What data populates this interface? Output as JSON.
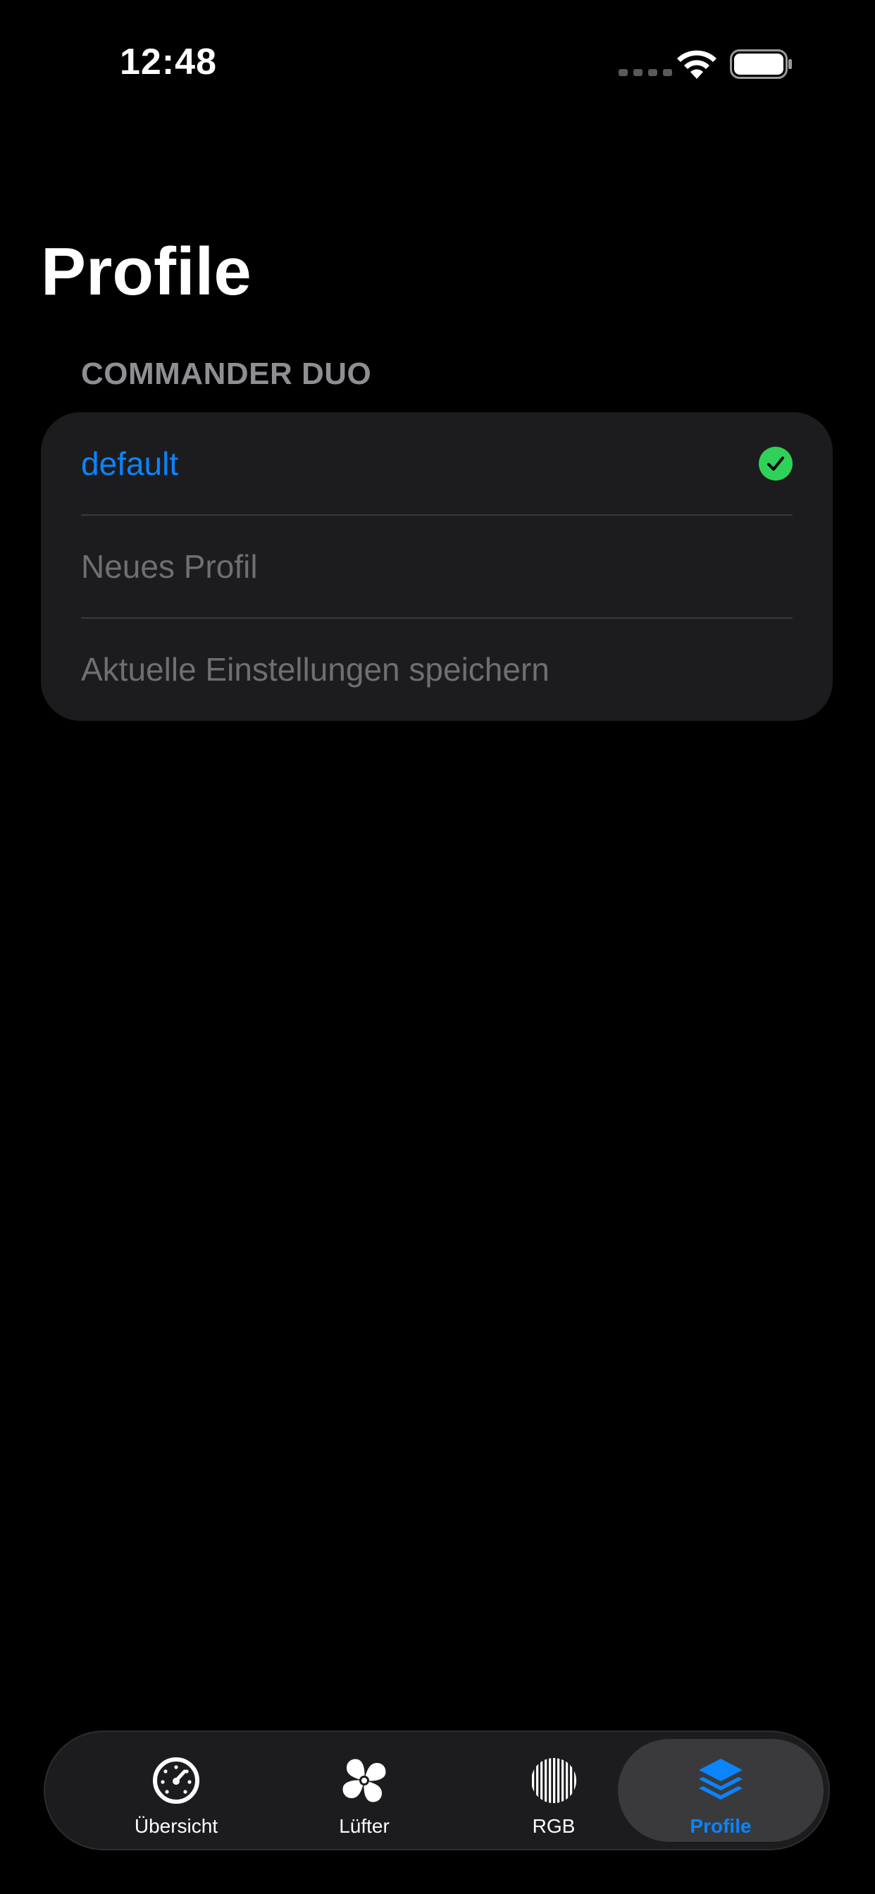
{
  "status_bar": {
    "time": "12:48"
  },
  "page": {
    "title": "Profile"
  },
  "section": {
    "header": "COMMANDER DUO",
    "rows": [
      {
        "label": "default",
        "selected": true
      },
      {
        "label": "Neues Profil",
        "selected": false
      },
      {
        "label": "Aktuelle Einstellungen speichern",
        "selected": false
      }
    ]
  },
  "tab_bar": {
    "tabs": [
      {
        "label": "Übersicht",
        "icon": "gauge-icon",
        "active": false
      },
      {
        "label": "Lüfter",
        "icon": "fan-icon",
        "active": false
      },
      {
        "label": "RGB",
        "icon": "rgb-stripes-icon",
        "active": false
      },
      {
        "label": "Profile",
        "icon": "layers-icon",
        "active": true
      }
    ]
  },
  "colors": {
    "accent": "#0a84ff",
    "check_green": "#30d158",
    "card_bg": "#1c1c1e",
    "muted_text": "#6e6e73",
    "section_header": "#8e8e93"
  }
}
